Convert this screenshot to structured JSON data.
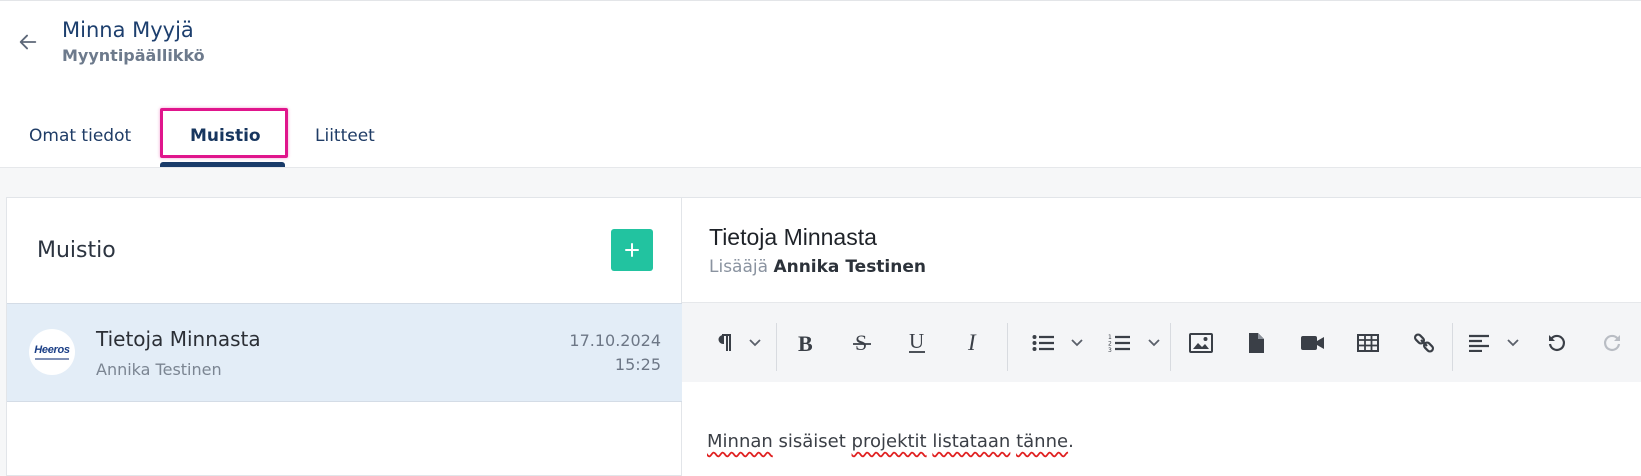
{
  "header": {
    "name": "Minna Myyjä",
    "role": "Myyntipäällikkö"
  },
  "tabs": [
    {
      "label": "Omat tiedot"
    },
    {
      "label": "Muistio"
    },
    {
      "label": "Liitteet"
    }
  ],
  "left_panel": {
    "title": "Muistio",
    "notes": [
      {
        "title": "Tietoja Minnasta",
        "author": "Annika Testinen",
        "date": "17.10.2024",
        "time": "15:25",
        "avatar_text": "Heeros"
      }
    ]
  },
  "right_panel": {
    "title": "Tietoja Minnasta",
    "added_by_label": "Lisääjä",
    "added_by_name": "Annika Testinen",
    "content": {
      "w1": "Minnan",
      "w2": " sisäiset ",
      "w3": "projektit",
      "w4": " ",
      "w5": "listataan",
      "w6": " ",
      "w7": "tänne",
      "w8": "."
    }
  },
  "colors": {
    "accent": "#22c3a0",
    "brand": "#1a3c6a",
    "highlight": "#e0158c",
    "selected_row": "#e3edf7"
  }
}
